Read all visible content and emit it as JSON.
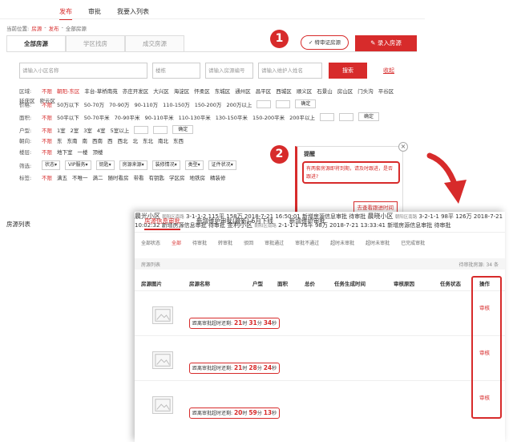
{
  "back": {
    "nav": [
      "发布",
      "审批",
      "我要入列表"
    ],
    "breadcrumb": [
      "当前位置:",
      "房源",
      "-",
      "发布",
      "-",
      "全部房源"
    ],
    "tabs": [
      "全部房源",
      "学区找房",
      "成交房源"
    ],
    "recommend_button": "特审证房源",
    "entry_button": "录入房源",
    "badge1": "1",
    "badge2": "2",
    "search": {
      "name_placeholder": "请输入小区名称",
      "building_placeholder": "楼栋",
      "id_placeholder": "请输入房源编号",
      "agent_placeholder": "请输入维护人姓名",
      "button": "搜索",
      "more": "收起"
    },
    "filters": [
      {
        "label": "区域:",
        "items": [
          "不限",
          "朝阳-东区",
          "丰台-草桥南苑",
          "亦庄开发区",
          "大兴区",
          "海淀区",
          "怀柔区",
          "东城区",
          "通州区",
          "昌平区",
          "西城区",
          "顺义区",
          "石景山",
          "房山区",
          "门头沟",
          "平谷区",
          "延庆区",
          "密云区"
        ]
      },
      {
        "label": "价格:",
        "items": [
          "不限",
          "50万以下",
          "50-70万",
          "70-90万",
          "90-110万",
          "110-150万",
          "150-200万",
          "200万以上"
        ]
      },
      {
        "label": "面积:",
        "items": [
          "不限",
          "50平以下",
          "50-70平米",
          "70-90平米",
          "90-110平米",
          "110-130平米",
          "130-150平米",
          "150-200平米",
          "200平以上"
        ]
      },
      {
        "label": "户型:",
        "items": [
          "不限",
          "1室",
          "2室",
          "3室",
          "4室",
          "5室以上"
        ]
      },
      {
        "label": "朝向:",
        "items": [
          "不限",
          "东",
          "东南",
          "南",
          "西南",
          "西",
          "西北",
          "北",
          "东北",
          "南北",
          "东西"
        ]
      },
      {
        "label": "楼层:",
        "items": [
          "不限",
          "地下室",
          "一楼",
          "顶楼"
        ]
      },
      {
        "label": "筛选:",
        "items": [
          "状态",
          "VIP服务",
          "钥匙",
          "房源来源",
          "装修情况",
          "类型",
          "证件状况"
        ]
      },
      {
        "label": "标签:",
        "items": [
          "不限",
          "满五",
          "不唯一",
          "满二",
          "随时看房",
          "带看",
          "有钥匙",
          "学区房",
          "地铁房",
          "精装修"
        ]
      }
    ],
    "confirm": "确定",
    "list_label": "房源列表"
  },
  "popup": {
    "title": "提醒",
    "message": "有两套房源即将到期，请及时跟进，是否跟进?",
    "view": "去查看跟进时间",
    "close": "×"
  },
  "front": {
    "tabs": [
      "房源信息审批",
      "新增维护审批(最新)-6月下线",
      "新增维护审批"
    ],
    "subtabs": [
      "全部状态",
      "全部",
      "待审批",
      "转审批",
      "驳回",
      "审批通过",
      "审批不通过",
      "超时未审批",
      "超时未审批",
      "已完成审批"
    ],
    "meta_left": "房源列表",
    "meta_right": "待审批房源: 34 条",
    "headers": [
      "房源图片",
      "房源名称",
      "户型",
      "面积",
      "总价",
      "任务生成时间",
      "审核原因",
      "任务状态",
      "操作"
    ],
    "rows": [
      {
        "name": "晨光小区",
        "sub": "朝阳区南路",
        "layout": "3-1-1-2",
        "area": "115平",
        "price": "158万",
        "time": "2018-7-21",
        "time2": "16:50:01",
        "reason": "新增房源信息审批",
        "status": "待审批",
        "timer_label": "距离审批超时还剩:",
        "h": "21",
        "m": "31",
        "s": "34",
        "action": "审核"
      },
      {
        "name": "晨晓小区",
        "sub": "朝阳区南路",
        "layout": "3-2-1-1",
        "area": "98平",
        "price": "126万",
        "time": "2018-7-21",
        "time2": "10:02:32",
        "reason": "新增房源信息审批",
        "status": "待审批",
        "timer_label": "距离审批超时还剩:",
        "h": "21",
        "m": "28",
        "s": "24",
        "action": "审核"
      },
      {
        "name": "金利小区",
        "sub": "朝阳区南路",
        "layout": "2-1-1-1",
        "area": "76平",
        "price": "98万",
        "time": "2018-7-21",
        "time2": "13:33:41",
        "reason": "新增房源信息审批",
        "status": "待审批",
        "timer_label": "距离审批超时还剩:",
        "h": "20",
        "m": "59",
        "s": "13",
        "action": "审核"
      }
    ],
    "unit_h": "时",
    "unit_m": "分",
    "unit_s": "秒"
  },
  "colors": {
    "accent": "#d72b2b"
  }
}
